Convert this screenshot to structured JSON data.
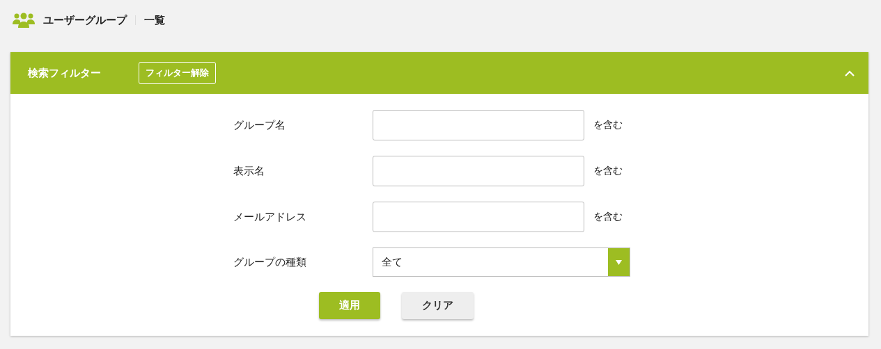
{
  "breadcrumb": {
    "title": "ユーザーグループ",
    "page": "一覧"
  },
  "filter": {
    "title": "検索フィルター",
    "clear_filter_button": "フィルター解除",
    "expanded": true,
    "fields": [
      {
        "label": "グループ名",
        "kind": "text",
        "suffix": "を含む"
      },
      {
        "label": "表示名",
        "kind": "text",
        "suffix": "を含む"
      },
      {
        "label": "メールアドレス",
        "kind": "text",
        "suffix": "を含む"
      },
      {
        "label": "グループの種類",
        "kind": "select",
        "value": "全て"
      }
    ],
    "buttons": [
      {
        "label": "適用",
        "kind": "primary"
      },
      {
        "label": "クリア",
        "kind": "secondary"
      }
    ]
  }
}
